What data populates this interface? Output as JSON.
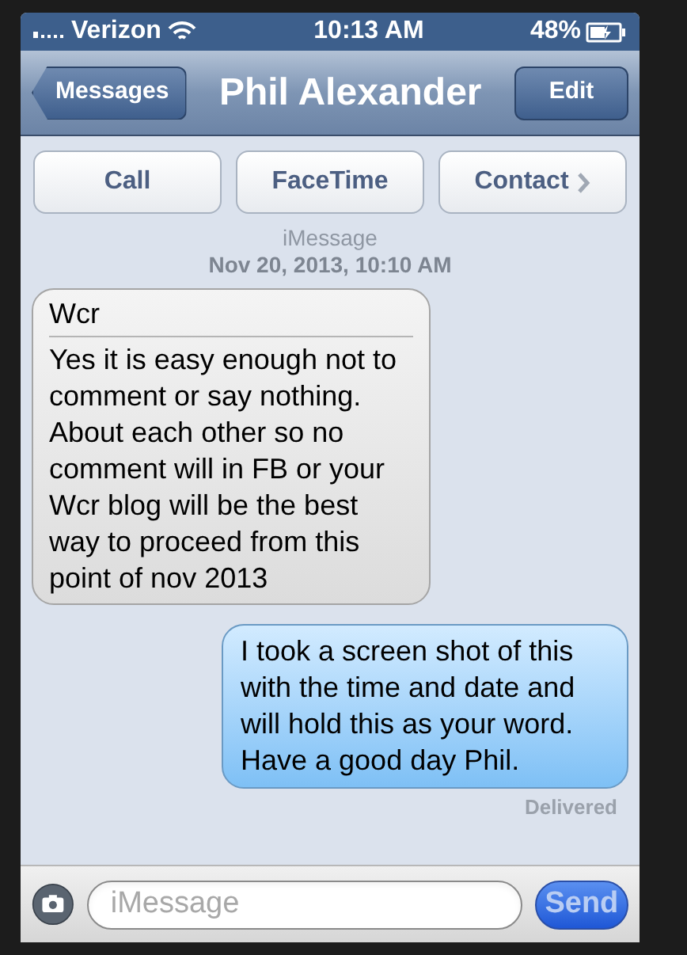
{
  "status_bar": {
    "carrier": "Verizon",
    "time": "10:13 AM",
    "battery": "48%"
  },
  "nav_bar": {
    "back": "Messages",
    "title": "Phil Alexander",
    "edit": "Edit"
  },
  "actions": [
    {
      "label": "Call",
      "chevron": false
    },
    {
      "label": "FaceTime",
      "chevron": false
    },
    {
      "label": "Contact",
      "chevron": true
    }
  ],
  "service": "iMessage",
  "timestamp": "Nov 20, 2013, 10:10 AM",
  "messages": [
    {
      "kind": "received",
      "subject": "Wcr",
      "text": "Yes it is easy enough not to comment or say nothing. About each other so no comment will in FB or your Wcr blog will be the best way to proceed from this point of nov 2013"
    },
    {
      "kind": "sent",
      "text": "I took a screen shot of this with the time and date and will hold this as your word. Have a good day Phil."
    }
  ],
  "receipt": "Delivered",
  "composer": {
    "placeholder": "iMessage",
    "send": "Send"
  }
}
